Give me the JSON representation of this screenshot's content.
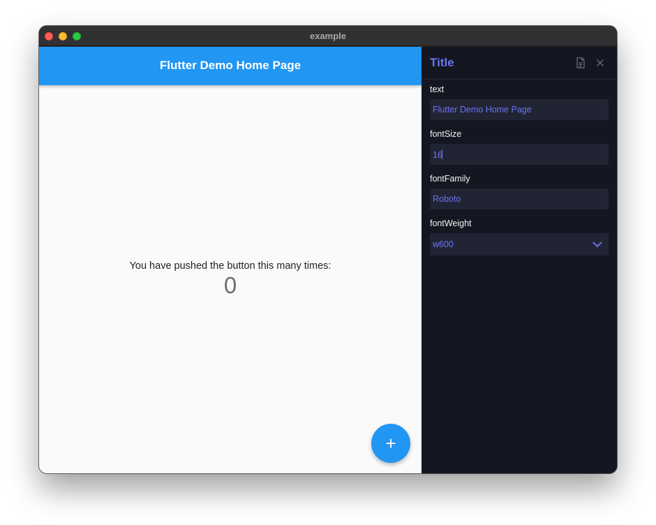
{
  "window": {
    "title": "example"
  },
  "app": {
    "appbar_title": "Flutter Demo Home Page",
    "counter_caption": "You have pushed the button this many times:",
    "counter_value": "0",
    "fab_label": "+"
  },
  "panel": {
    "title": "Title",
    "icons": [
      "document-icon",
      "close-icon"
    ],
    "fields": {
      "text": {
        "label": "text",
        "value": "Flutter Demo Home Page"
      },
      "fontSize": {
        "label": "fontSize",
        "value": "16"
      },
      "fontFamily": {
        "label": "fontFamily",
        "value": "Roboto"
      },
      "fontWeight": {
        "label": "fontWeight",
        "value": "w600"
      }
    }
  },
  "colors": {
    "appbar": "#2196f3",
    "fab": "#2196f3",
    "panel_bg": "#141721",
    "panel_accent": "#6a73ef",
    "input_bg": "#212433"
  }
}
